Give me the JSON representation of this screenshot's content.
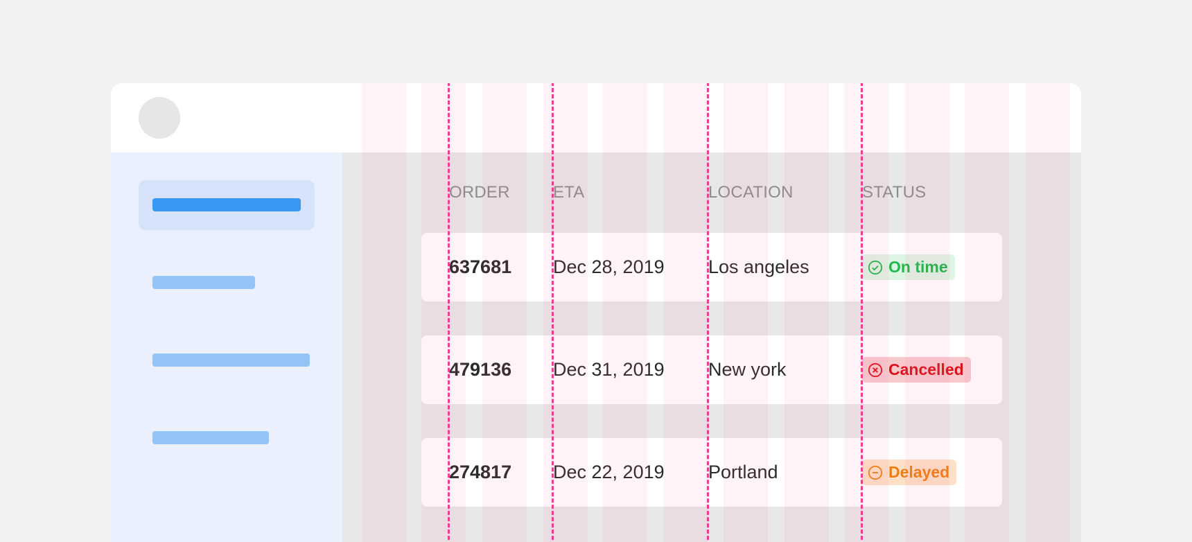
{
  "table": {
    "headers": {
      "order": "ORDER",
      "eta": "ETA",
      "location": "LOCATION",
      "status": "STATUS"
    },
    "rows": [
      {
        "order": "637681",
        "eta": "Dec 28, 2019",
        "location": "Los angeles",
        "status": "On time",
        "status_type": "success"
      },
      {
        "order": "479136",
        "eta": "Dec 31, 2019",
        "location": "New york",
        "status": "Cancelled",
        "status_type": "error"
      },
      {
        "order": "274817",
        "eta": "Dec 22, 2019",
        "location": "Portland",
        "status": "Delayed",
        "status_type": "warning"
      }
    ]
  },
  "sidebar": {
    "items": [
      {
        "icon": "placeholder-bar",
        "active": true
      },
      {
        "icon": "placeholder-bar",
        "active": false
      },
      {
        "icon": "placeholder-bar",
        "active": false
      },
      {
        "icon": "placeholder-bar",
        "active": false
      }
    ]
  },
  "icons": {
    "on_time": "check-circle-icon",
    "cancelled": "x-circle-icon",
    "delayed": "minus-circle-icon"
  },
  "colors": {
    "success_text": "#1fb84a",
    "success_bg": "#dff5e4",
    "error_text": "#e0101a",
    "error_bg": "#f7c9cc",
    "warning_text": "#f07d12",
    "warning_bg": "#fde0c6",
    "accent": "#3897f0",
    "guide": "#ee3d95"
  }
}
